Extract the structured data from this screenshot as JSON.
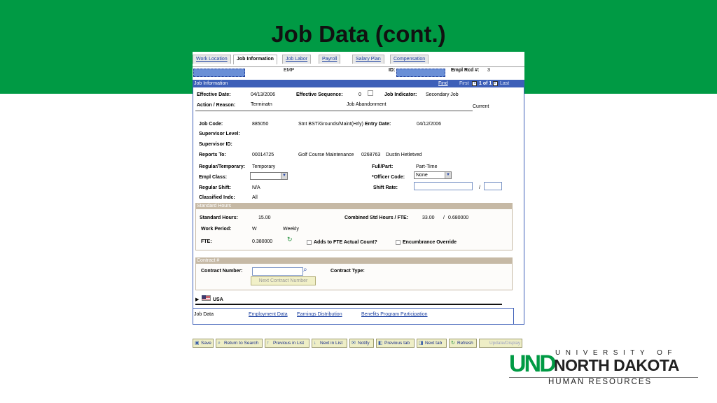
{
  "slide": {
    "title": "Job Data (cont.)",
    "colors": {
      "banner": "#009a44",
      "header_blue": "#3d5fb8",
      "section_tan": "#c6b9a5"
    }
  },
  "tabs": [
    "Work Location",
    "Job Information",
    "Job Labor",
    "Payroll",
    "Salary Plan",
    "Compensation"
  ],
  "active_tab": "Job Information",
  "top": {
    "emp_label": "EMP",
    "id_label": "ID:",
    "empl_rcd_label": "Empl Rcd #:",
    "empl_rcd_value": "3"
  },
  "job_info": {
    "header": "Job Information",
    "find": "Find",
    "first": "First",
    "count": "1 of 1",
    "last": "Last",
    "effective_date_label": "Effective Date:",
    "effective_date": "04/13/2006",
    "effective_sequence_label": "Effective Sequence:",
    "effective_sequence": "0",
    "job_indicator_label": "Job Indicator:",
    "job_indicator": "Secondary Job",
    "action_reason_label": "Action / Reason:",
    "action": "Terminatn",
    "reason": "Job Abandonment",
    "status": "Current",
    "job_code_label": "Job Code:",
    "job_code": "885050",
    "job_code_desc": "Stnt BST/Grounds/Maint(Hrly)",
    "entry_date_label": "Entry Date:",
    "entry_date": "04/12/2006",
    "supervisor_level_label": "Supervisor Level:",
    "supervisor_id_label": "Supervisor ID:",
    "reports_to_label": "Reports To:",
    "reports_to": "00014725",
    "reports_to_desc": "Golf Course Maintenance",
    "reports_to_emp": "0268763",
    "reports_to_name": "Dustin Hetletved",
    "regular_temporary_label": "Regular/Temporary:",
    "regular_temporary": "Temporary",
    "full_part_label": "Full/Part:",
    "full_part": "Part-Time",
    "empl_class_label": "Empl Class:",
    "officer_code_label": "*Officer Code:",
    "officer_code": "None",
    "regular_shift_label": "Regular Shift:",
    "regular_shift": "N/A",
    "shift_rate_label": "Shift Rate:",
    "shift_rate_sep": "/",
    "classified_indc_label": "Classified Indc:",
    "classified_indc": "All"
  },
  "standard_hours": {
    "header": "Standard Hours",
    "standard_hours_label": "Standard Hours:",
    "standard_hours": "15.00",
    "combined_label": "Combined Std Hours / FTE:",
    "combined_hours": "33.00",
    "combined_sep": "/",
    "combined_fte": "0.680000",
    "work_period_label": "Work Period:",
    "work_period": "W",
    "work_period_desc": "Weekly",
    "fte_label": "FTE:",
    "fte": "0.380000",
    "adds_to_fte_label": "Adds to FTE Actual Count?",
    "encumbrance_label": "Encumbrance Override"
  },
  "contract": {
    "header": "Contract #",
    "contract_number_label": "Contract Number:",
    "contract_type_label": "Contract Type:",
    "next_contract_button": "Next Contract Number"
  },
  "usa_label": "USA",
  "links": {
    "job_data": "Job Data",
    "employment_data": "Employment Data",
    "earnings_distribution": "Earnings Distribution",
    "benefits_program": "Benefits Program Participation"
  },
  "toolbar": [
    {
      "label": "Save",
      "icon": "save-icon",
      "glyph": "▣"
    },
    {
      "label": "Return to Search",
      "icon": "search-icon",
      "glyph": "⌕"
    },
    {
      "label": "Previous in List",
      "icon": "previous-in-list-icon",
      "glyph": "↑"
    },
    {
      "label": "Next in List",
      "icon": "next-in-list-icon",
      "glyph": "↓"
    },
    {
      "label": "Notify",
      "icon": "notify-icon",
      "glyph": "✉"
    },
    {
      "label": "Previous tab",
      "icon": "previous-tab-icon",
      "glyph": "◧"
    },
    {
      "label": "Next tab",
      "icon": "next-tab-icon",
      "glyph": "◨"
    },
    {
      "label": "Refresh",
      "icon": "refresh-icon",
      "glyph": "↻"
    },
    {
      "label": "Update/Display",
      "icon": "update-display-icon",
      "glyph": ""
    }
  ],
  "logo": {
    "und": "UND",
    "university_of": "UNIVERSITY OF",
    "north_dakota": "NORTH DAKOTA",
    "human_resources": "HUMAN RESOURCES"
  }
}
